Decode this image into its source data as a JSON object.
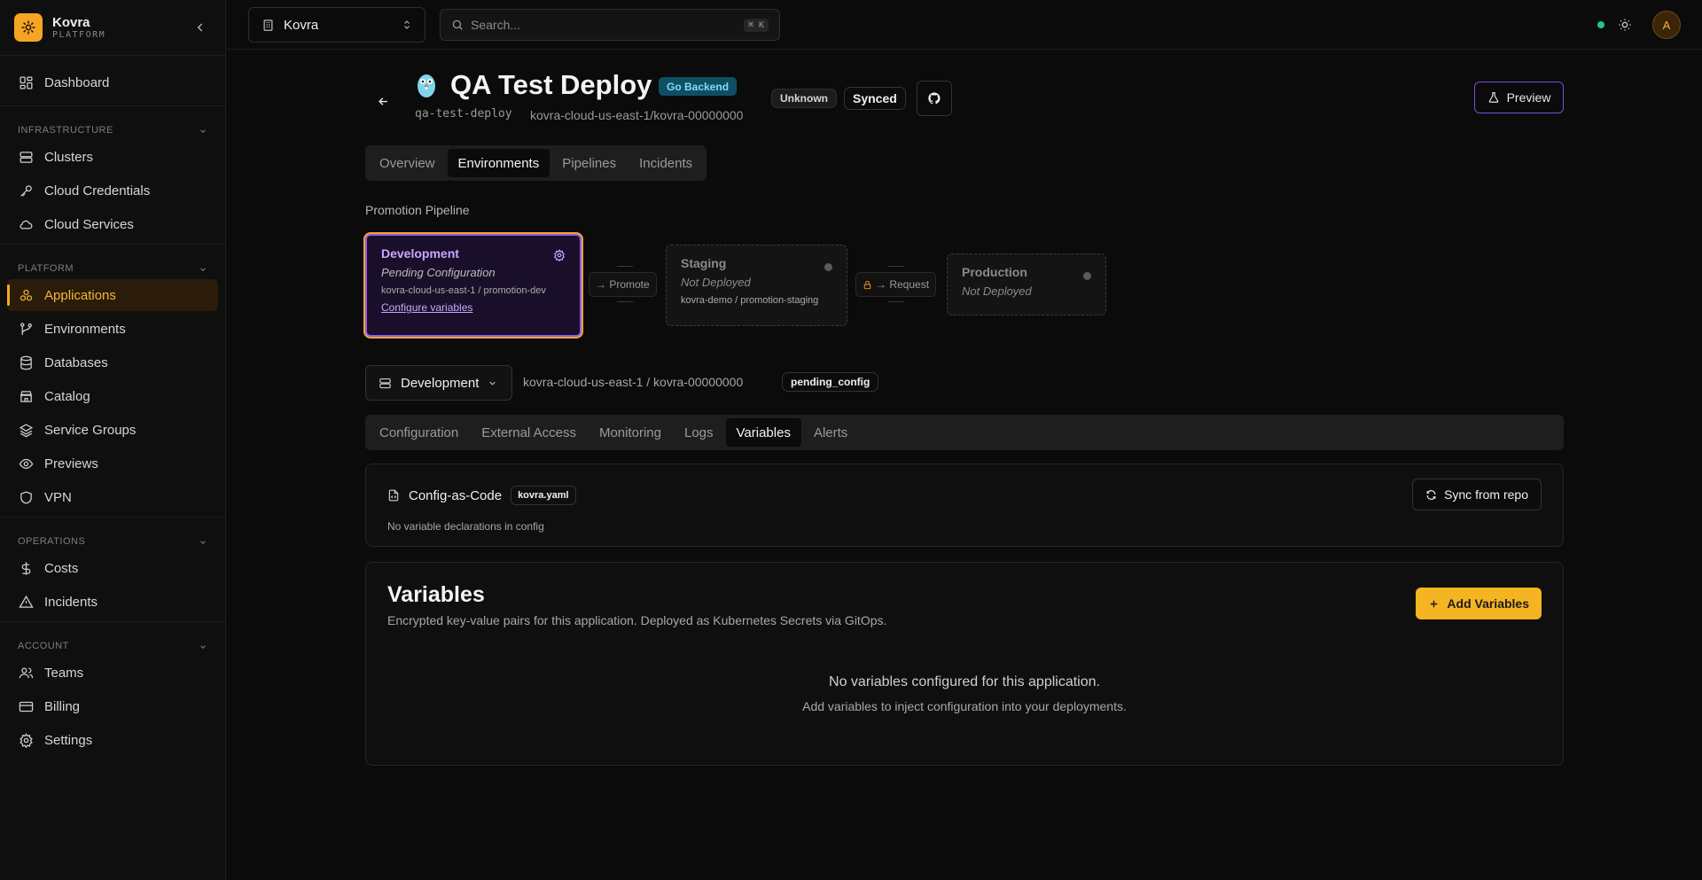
{
  "brand": {
    "name": "Kovra",
    "subtitle": "PLATFORM"
  },
  "sidebar": {
    "top_items": [
      {
        "label": "Dashboard",
        "icon": "dashboard-icon"
      }
    ],
    "sections": [
      {
        "title": "INFRASTRUCTURE",
        "items": [
          {
            "label": "Clusters",
            "icon": "server-icon"
          },
          {
            "label": "Cloud Credentials",
            "icon": "key-icon"
          },
          {
            "label": "Cloud Services",
            "icon": "cloud-icon"
          }
        ]
      },
      {
        "title": "PLATFORM",
        "items": [
          {
            "label": "Applications",
            "icon": "applications-icon",
            "active": true
          },
          {
            "label": "Environments",
            "icon": "branch-icon"
          },
          {
            "label": "Databases",
            "icon": "database-icon"
          },
          {
            "label": "Catalog",
            "icon": "store-icon"
          },
          {
            "label": "Service Groups",
            "icon": "layers-icon"
          },
          {
            "label": "Previews",
            "icon": "eye-icon"
          },
          {
            "label": "VPN",
            "icon": "shield-icon"
          }
        ]
      },
      {
        "title": "OPERATIONS",
        "items": [
          {
            "label": "Costs",
            "icon": "dollar-icon"
          },
          {
            "label": "Incidents",
            "icon": "warning-icon"
          }
        ]
      },
      {
        "title": "ACCOUNT",
        "items": [
          {
            "label": "Teams",
            "icon": "users-icon"
          },
          {
            "label": "Billing",
            "icon": "credit-card-icon"
          },
          {
            "label": "Settings",
            "icon": "gear-icon"
          }
        ]
      }
    ]
  },
  "topbar": {
    "org": "Kovra",
    "search_placeholder": "Search...",
    "shortcut": "⌘ K",
    "user_initial": "A"
  },
  "app": {
    "title": "QA Test Deploy",
    "language_badge": "Go Backend",
    "health": "Unknown",
    "sync_status": "Synced",
    "slug": "qa-test-deploy",
    "cluster_path": "kovra-cloud-us-east-1/kovra-00000000",
    "preview_label": "Preview"
  },
  "main_tabs": [
    "Overview",
    "Environments",
    "Pipelines",
    "Incidents"
  ],
  "main_tabs_active": "Environments",
  "pipeline": {
    "label": "Promotion Pipeline",
    "development": {
      "name": "Development",
      "state": "Pending Configuration",
      "target": "kovra-cloud-us-east-1 / promotion-dev",
      "link": "Configure variables"
    },
    "promote_label": "→ Promote",
    "staging": {
      "name": "Staging",
      "state": "Not Deployed",
      "target": "kovra-demo / promotion-staging"
    },
    "request_label": "→ Request",
    "production": {
      "name": "Production",
      "state": "Not Deployed"
    }
  },
  "env_bar": {
    "selected": "Development",
    "path": "kovra-cloud-us-east-1 / kovra-00000000",
    "status": "pending_config"
  },
  "sub_tabs": [
    "Configuration",
    "External Access",
    "Monitoring",
    "Logs",
    "Variables",
    "Alerts"
  ],
  "sub_tabs_active": "Variables",
  "config_as_code": {
    "title": "Config-as-Code",
    "file": "kovra.yaml",
    "message": "No variable declarations in config",
    "sync_label": "Sync from repo"
  },
  "variables": {
    "title": "Variables",
    "description": "Encrypted key-value pairs for this application. Deployed as Kubernetes Secrets via GitOps.",
    "add_label": "Add Variables",
    "empty_title": "No variables configured for this application.",
    "empty_sub": "Add variables to inject configuration into your deployments."
  },
  "colors": {
    "accent": "#f5a524",
    "purple": "#8b5cf6",
    "status_online": "#22c39a"
  }
}
